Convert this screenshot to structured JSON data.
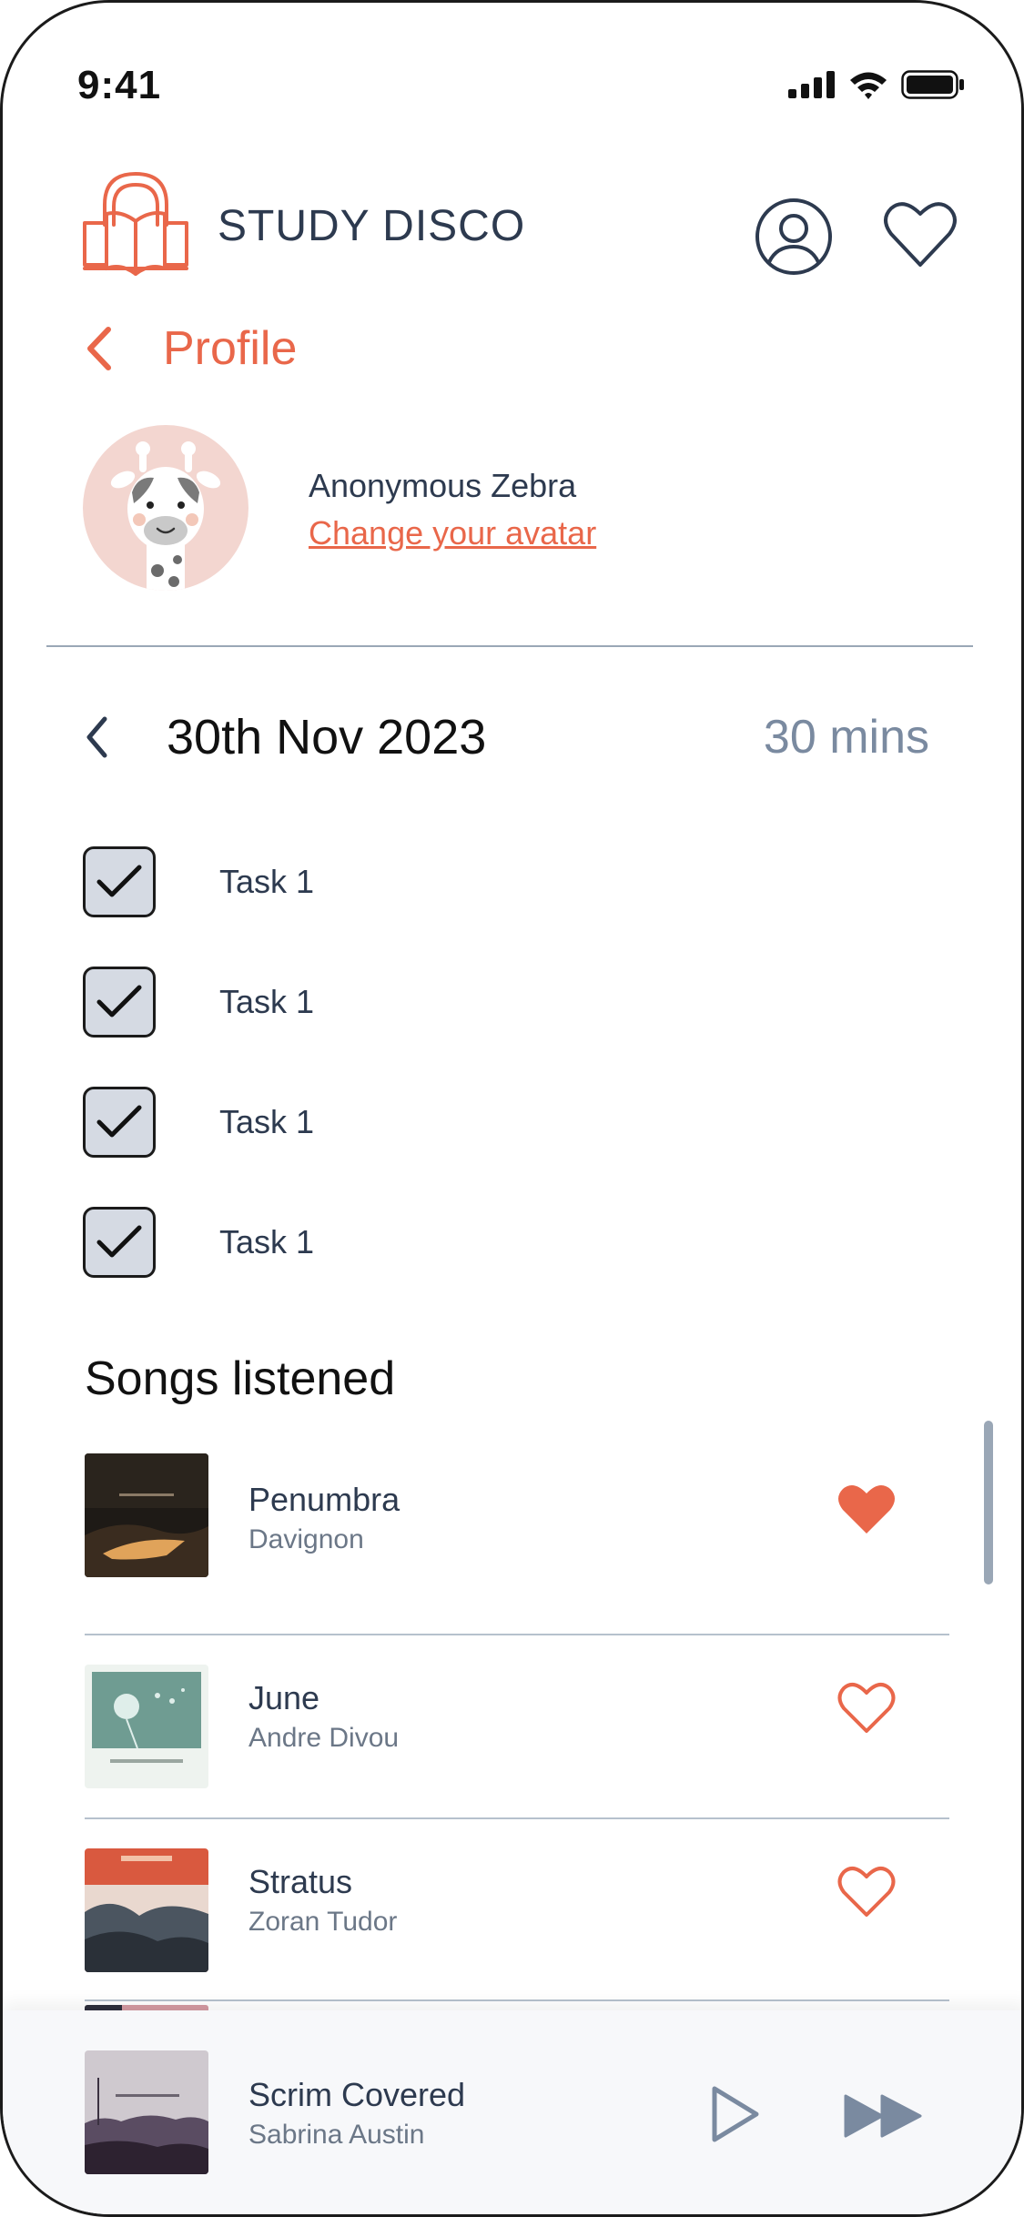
{
  "status_bar": {
    "time": "9:41"
  },
  "header": {
    "app_title": "STUDY DISCO"
  },
  "nav": {
    "back_label": "Profile"
  },
  "profile": {
    "name": "Anonymous Zebra",
    "change_avatar": "Change your avatar"
  },
  "session": {
    "date": "30th Nov 2023",
    "duration": "30 mins"
  },
  "tasks": [
    {
      "label": "Task 1",
      "checked": true
    },
    {
      "label": "Task 1",
      "checked": true
    },
    {
      "label": "Task 1",
      "checked": true
    },
    {
      "label": "Task 1",
      "checked": true
    }
  ],
  "songs_section": {
    "title": "Songs listened"
  },
  "songs": [
    {
      "title": "Penumbra",
      "artist": "Davignon",
      "liked": true
    },
    {
      "title": "June",
      "artist": "Andre Divou",
      "liked": false
    },
    {
      "title": "Stratus",
      "artist": "Zoran Tudor",
      "liked": false
    }
  ],
  "now_playing": {
    "title": "Scrim Covered",
    "artist": "Sabrina Austin"
  },
  "colors": {
    "accent": "#e9674a",
    "text": "#2d3a4f",
    "muted": "#7a8aa0",
    "divider": "#9aa7b6"
  },
  "icons": [
    "signal-icon",
    "wifi-icon",
    "battery-icon",
    "headphones-book-logo",
    "profile-icon",
    "heart-icon",
    "chevron-left-icon",
    "checkmark-icon",
    "play-icon",
    "fast-forward-icon"
  ]
}
